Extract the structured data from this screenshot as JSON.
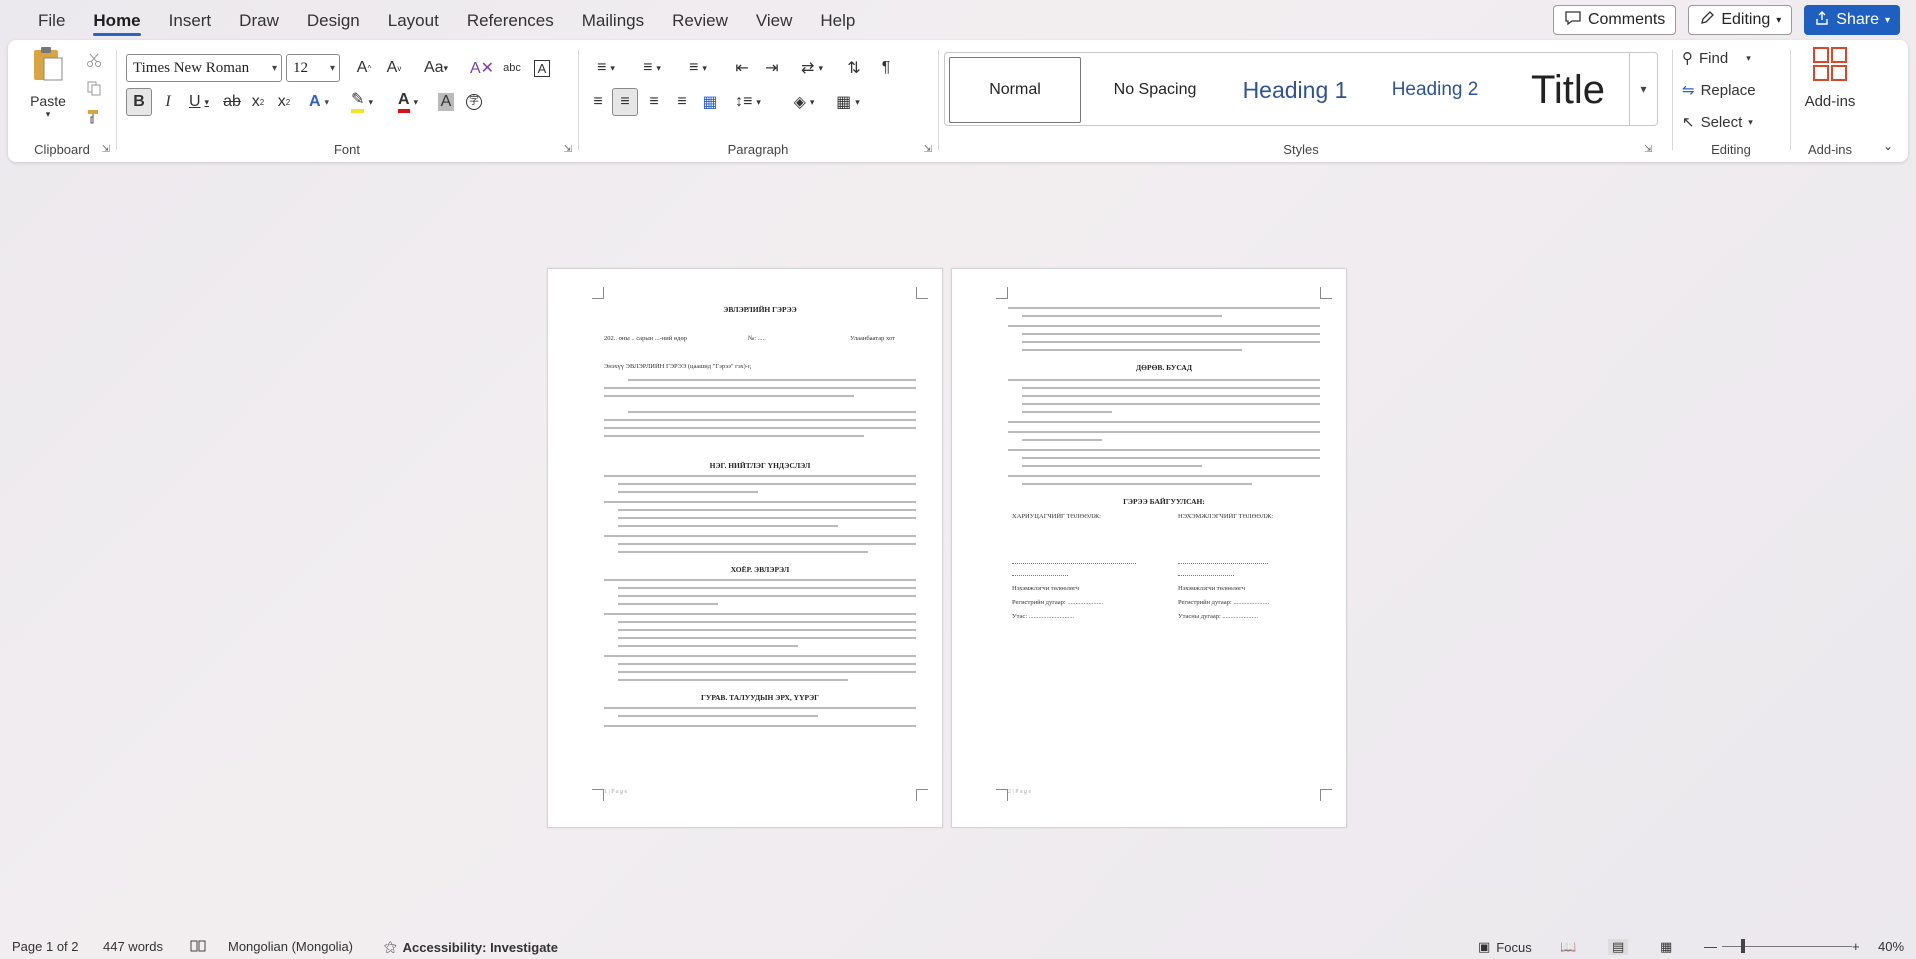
{
  "menu": {
    "tabs": [
      "File",
      "Home",
      "Insert",
      "Draw",
      "Design",
      "Layout",
      "References",
      "Mailings",
      "Review",
      "View",
      "Help"
    ],
    "active": "Home",
    "comments_label": "Comments",
    "editing_label": "Editing",
    "share_label": "Share"
  },
  "ribbon": {
    "clipboard": {
      "label": "Clipboard",
      "paste_label": "Paste"
    },
    "font": {
      "label": "Font",
      "font_name": "Times New Roman",
      "font_size": "12"
    },
    "paragraph": {
      "label": "Paragraph"
    },
    "styles": {
      "label": "Styles",
      "items": [
        "Normal",
        "No Spacing",
        "Heading 1",
        "Heading 2",
        "Title"
      ]
    },
    "editing": {
      "label": "Editing",
      "find": "Find",
      "replace": "Replace",
      "select": "Select"
    },
    "addins": {
      "label": "Add-ins",
      "button": "Add-ins"
    }
  },
  "document": {
    "page1": {
      "title": "ЭВЛЭРЛИЙН ГЭРЭЭ",
      "date_line": "202.. оны .. сарын ...-ний өдөр",
      "number": "№: .....",
      "city": "Улаанбаатар хот",
      "intro": "Энэхүү ЭВЛЭРЛИЙН ГЭРЭЭ (цаашид \"Гэрээ\" гэх)-г,",
      "section1": "НЭГ. НИЙТЛЭГ ҮНДЭСЛЭЛ",
      "section2": "ХОЁР. ЭВЛЭРЭЛ",
      "section3": "ГУРАВ. ТАЛУУДЫН ЭРХ, ҮҮРЭГ",
      "footer": "1 | P a g e"
    },
    "page2": {
      "section4": "ДӨРӨВ. БУСАД",
      "signed": "ГЭРЭЭ БАЙГУУЛСАН:",
      "party1": "ХАРИУЦАГЧИЙГ ТӨЛӨӨЛЖ:",
      "party2": "НЭХЭМЖЛЭГЧИЙГ ТӨЛӨӨЛЖ:",
      "rep1": "Нэхэмжлэгчи төлөөлөгч",
      "rep2": "Нэхэмжлэгчи төлөөлөгч",
      "reg1": "Регистрийн дугаар: ......................",
      "reg2": "Регистрийн дугаар: ......................",
      "phone1": "Утас: ............................",
      "phone2": "Утасны дугаар: ......................",
      "footer": "2 | P a g e"
    }
  },
  "status": {
    "page": "Page 1 of 2",
    "words": "447 words",
    "language": "Mongolian (Mongolia)",
    "accessibility": "Accessibility: Investigate",
    "focus": "Focus",
    "zoom": "40%"
  }
}
